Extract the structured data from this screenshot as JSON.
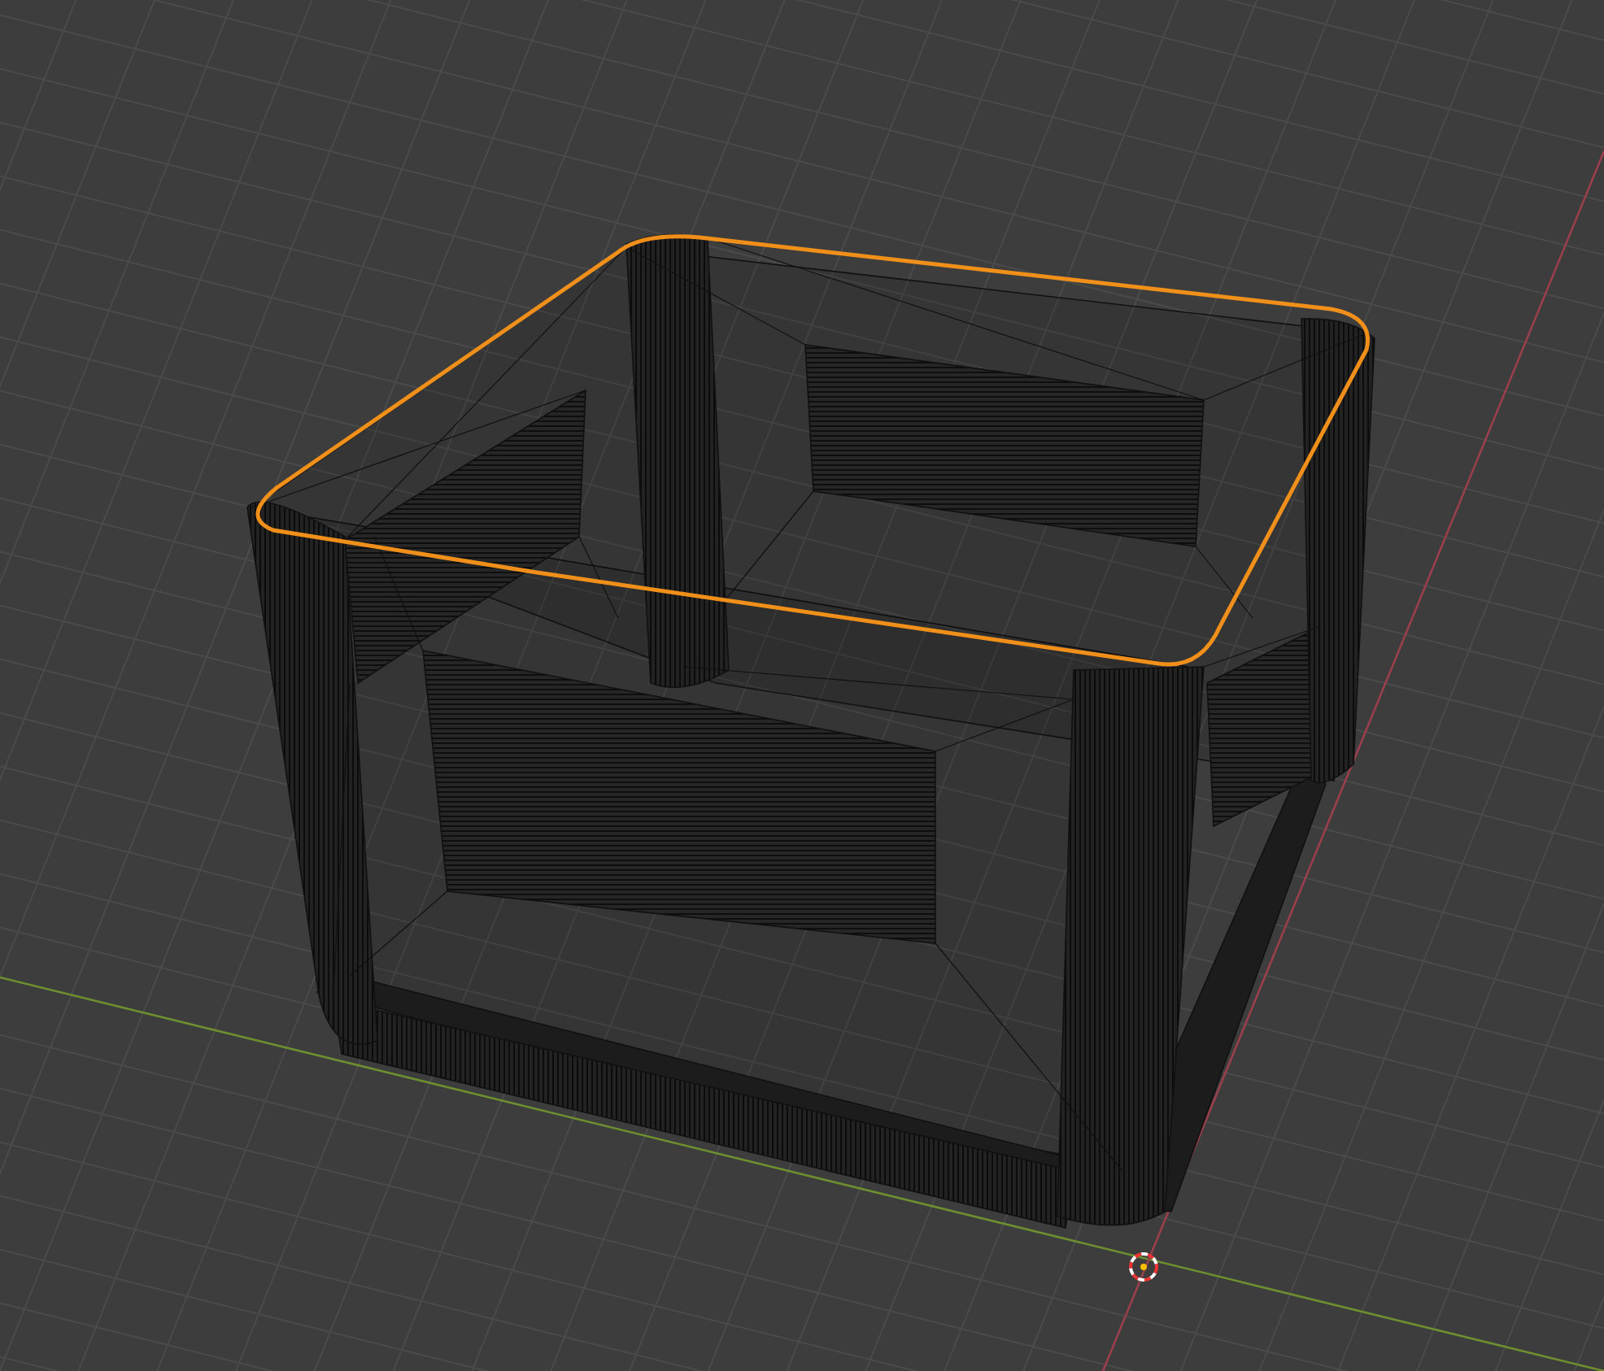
{
  "viewport": {
    "wireframe": true,
    "selection_outline": true
  }
}
